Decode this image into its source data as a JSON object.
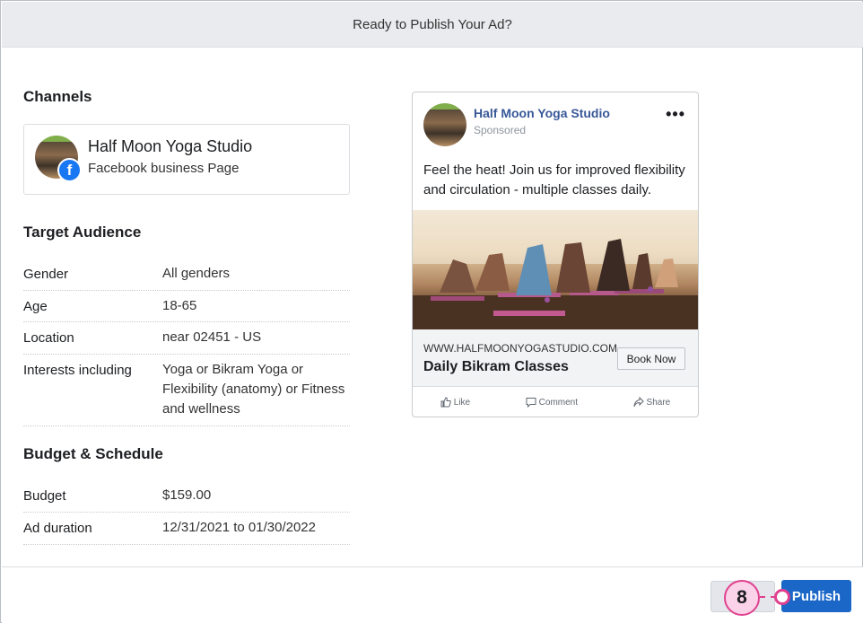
{
  "dialog": {
    "title": "Ready to Publish Your Ad?"
  },
  "channels": {
    "heading": "Channels",
    "page_name": "Half Moon Yoga Studio",
    "page_type": "Facebook business Page",
    "badge_glyph": "f"
  },
  "audience": {
    "heading": "Target Audience",
    "rows": [
      {
        "key": "Gender",
        "value": "All genders"
      },
      {
        "key": "Age",
        "value": "18-65"
      },
      {
        "key": "Location",
        "value": "near 02451 - US"
      },
      {
        "key": "Interests including",
        "value": "Yoga or Bikram Yoga or Flexibility (anatomy) or Fitness and wellness"
      }
    ]
  },
  "budget": {
    "heading": "Budget & Schedule",
    "rows": [
      {
        "key": "Budget",
        "value": "$159.00"
      },
      {
        "key": "Ad duration",
        "value": "12/31/2021 to 01/30/2022"
      }
    ]
  },
  "preview": {
    "page_name": "Half Moon Yoga Studio",
    "sponsored": "Sponsored",
    "more": "•••",
    "text": "Feel the heat! Join us for improved flexibility and circulation - multiple classes daily.",
    "url": "WWW.HALFMOONYOGASTUDIO.COM",
    "headline": "Daily Bikram Classes",
    "cta": "Book Now",
    "actions": {
      "like": "Like",
      "comment": "Comment",
      "share": "Share"
    }
  },
  "footer": {
    "cancel_label": "",
    "publish_label": "Publish"
  },
  "annotation": {
    "step": "8",
    "color": "#e0408f"
  },
  "colors": {
    "publish": "#1b67c8",
    "link_name": "#385898",
    "facebook": "#1877f2"
  }
}
